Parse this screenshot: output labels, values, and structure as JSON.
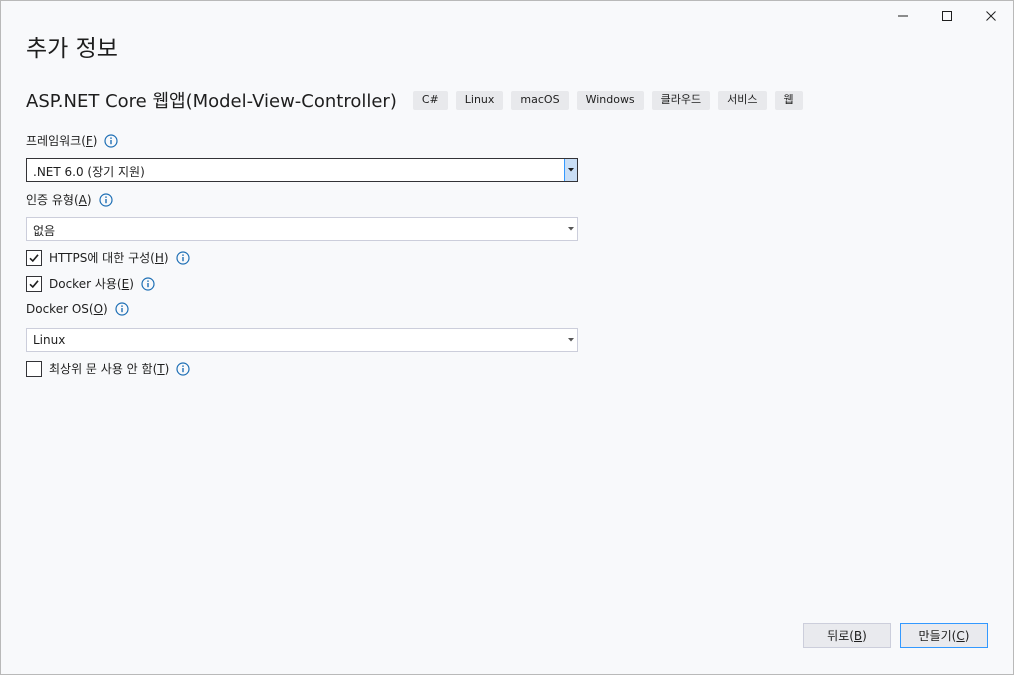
{
  "dialog": {
    "title": "추가 정보"
  },
  "template": {
    "name": "ASP.NET Core 웹앱(Model-View-Controller)",
    "tags": [
      "C#",
      "Linux",
      "macOS",
      "Windows",
      "클라우드",
      "서비스",
      "웹"
    ]
  },
  "framework": {
    "label": "프레임워크(",
    "mnemonic": "F",
    "label_end": ")",
    "value": ".NET 6.0 (장기 지원)"
  },
  "auth": {
    "label": "인증 유형(",
    "mnemonic": "A",
    "label_end": ")",
    "value": "없음"
  },
  "https": {
    "label": "HTTPS에 대한 구성(",
    "mnemonic": "H",
    "label_end": ")",
    "checked": true
  },
  "docker": {
    "label": "Docker 사용(",
    "mnemonic": "E",
    "label_end": ")",
    "checked": true
  },
  "docker_os": {
    "label": "Docker OS(",
    "mnemonic": "O",
    "label_end": ")",
    "value": "Linux"
  },
  "toplevel": {
    "label": "최상위 문 사용 안 함(",
    "mnemonic": "T",
    "label_end": ")",
    "checked": false
  },
  "buttons": {
    "back_label": "뒤로(",
    "back_mnemonic": "B",
    "back_end": ")",
    "create_label": "만들기(",
    "create_mnemonic": "C",
    "create_end": ")"
  },
  "colors": {
    "info_icon": "#1e6fb5",
    "accent": "#3399ff"
  }
}
